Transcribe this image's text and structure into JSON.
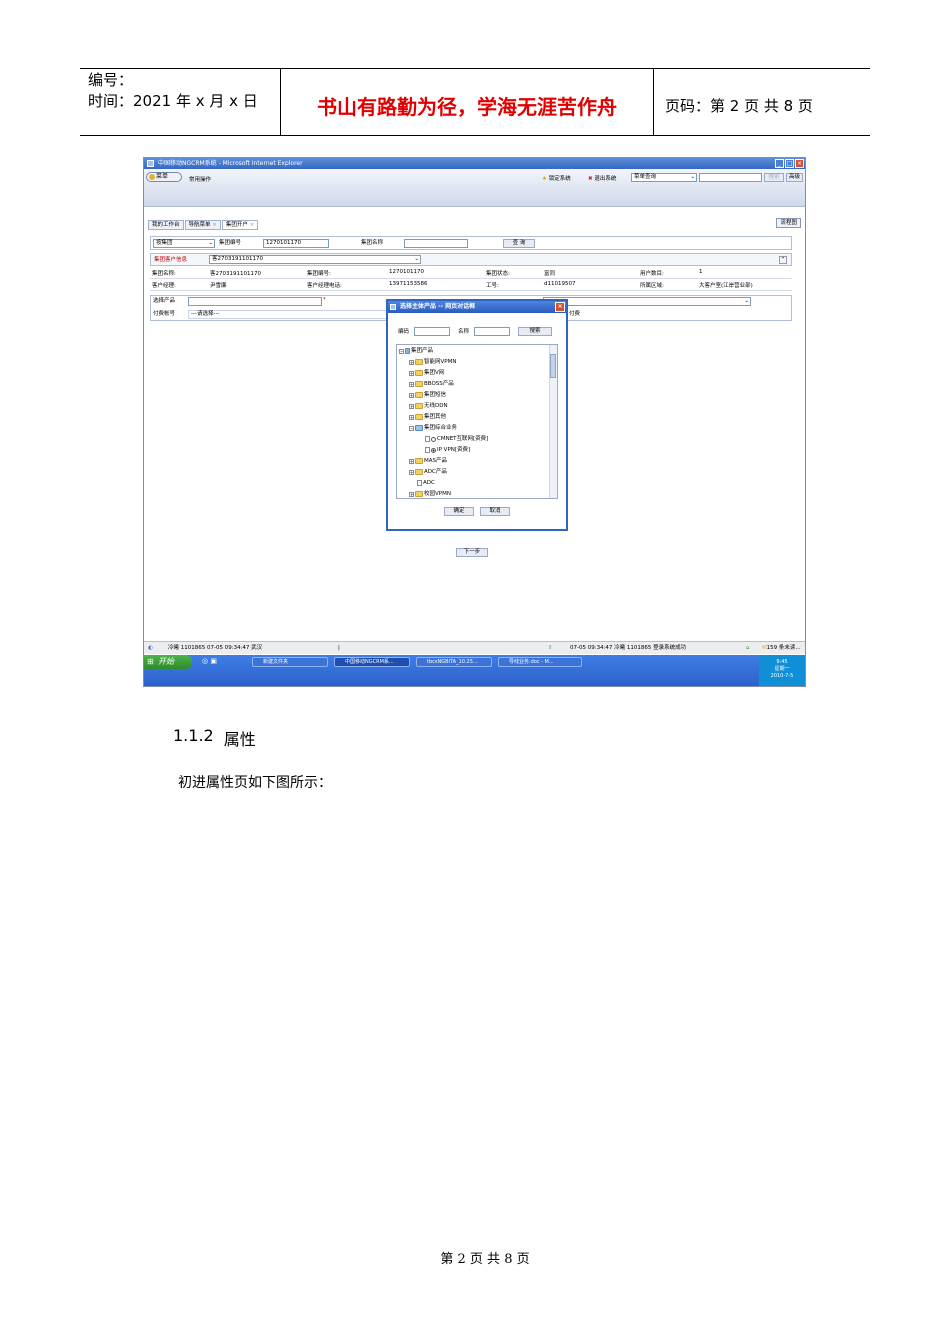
{
  "header": {
    "number_label": "编号：",
    "time_label": "时间：2021 年 x 月 x 日",
    "motto": "书山有路勤为径，学海无涯苦作舟",
    "page_info": "页码：第 2 页  共 8 页"
  },
  "screenshot": {
    "window_title": "中国移动NGCRM系统 - Microsoft Internet Explorer",
    "menu_label": "菜单",
    "common_ops": "常用操作",
    "lock_system": "锁定系统",
    "exit_system": "退出系统",
    "menu_query_value": "菜单查询",
    "search_btn": "搜索",
    "advanced_btn": "高级",
    "tabs": [
      "我的工作台",
      "导航菜单",
      "集团开户"
    ],
    "flowchart_btn": "流程图",
    "query_type_value": "按集团",
    "group_code_label": "集团编号",
    "group_code_value": "1270101170",
    "group_name_label": "集团名称",
    "query_btn": "查 询",
    "customer_info_label": "集团客户信息",
    "customer_select_value": "客2703191101170",
    "info_rows": [
      [
        "集团名称:",
        "客2703191101170",
        "集团编号:",
        "1270101170",
        "集团状态:",
        "富同",
        "用户数目:",
        "1"
      ],
      [
        "客户经理:",
        "尹雪廉",
        "客户经理电话:",
        "13971153586",
        "工号:",
        "d11019507",
        "所属区域:",
        "大客户室(江岸营业部)"
      ]
    ],
    "select_product_label": "选择产品",
    "payment_account_label": "付费帐号",
    "payment_account_value": "---请选择---",
    "payment_suffix": "付费",
    "next_btn": "下一步",
    "dialog": {
      "title": "选择主体产品 -- 网页对话框",
      "code_label": "编码",
      "name_label": "名称",
      "search_btn": "搜索",
      "tree_root": "集团产品",
      "tree_items": [
        "智能网VPMN",
        "集团V网",
        "BBOSS产品",
        "集团短信",
        "无线DDN",
        "集团其他",
        "集团综合业务",
        "CMNET互联网[资费]",
        "IP VPN[资费]",
        "MAS产品",
        "ADC产品",
        "ADC",
        "校园VPMN"
      ],
      "ok_btn": "确定",
      "cancel_btn": "取消"
    },
    "status_left": "冷曦 1101865  07-05 09:34:47 武汉",
    "status_pipe": "|",
    "status_mid": "07-05 09:34:47  冷曦 1101865 登录系统成功",
    "status_right": "159 条未读...",
    "start_btn": "开始",
    "tasks": [
      "新建文件夹",
      "中国移动NGCRM系...",
      "tbcsNGBITA_10.25...",
      "导线业务.doc - M..."
    ],
    "tray_time": "9:45",
    "tray_day": "星期一",
    "tray_date": "2010-7-5"
  },
  "section": {
    "number": "1.1.2",
    "title": "属性"
  },
  "paragraph": "初进属性页如下图所示：",
  "footer": "第 2 页 共 8 页"
}
